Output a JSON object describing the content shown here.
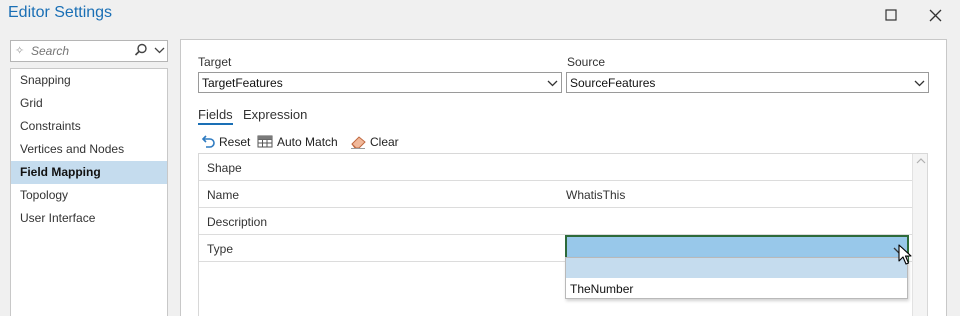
{
  "window": {
    "title": "Editor Settings"
  },
  "search": {
    "placeholder": "Search"
  },
  "sidebar": {
    "items": [
      {
        "label": "Snapping"
      },
      {
        "label": "Grid"
      },
      {
        "label": "Constraints"
      },
      {
        "label": "Vertices and Nodes"
      },
      {
        "label": "Field Mapping",
        "selected": true
      },
      {
        "label": "Topology"
      },
      {
        "label": "User Interface"
      }
    ]
  },
  "target": {
    "label": "Target",
    "value": "TargetFeatures"
  },
  "source": {
    "label": "Source",
    "value": "SourceFeatures"
  },
  "tabs": [
    {
      "label": "Fields",
      "active": true
    },
    {
      "label": "Expression"
    }
  ],
  "toolbar": {
    "reset_label": "Reset",
    "auto_match_label": "Auto Match",
    "clear_label": "Clear"
  },
  "fields_table": {
    "rows": [
      {
        "target": "Shape",
        "source": ""
      },
      {
        "target": "Name",
        "source": "WhatisThis"
      },
      {
        "target": "Description",
        "source": ""
      },
      {
        "target": "Type",
        "source": ""
      }
    ]
  },
  "type_dropdown": {
    "options": [
      "",
      "TheNumber"
    ],
    "highlighted_index": 0
  },
  "colors": {
    "accent": "#1a6fb5",
    "selection": "#c5dcee",
    "edit_cell": "#98c8ea",
    "edit_border": "#2d6a3a"
  }
}
